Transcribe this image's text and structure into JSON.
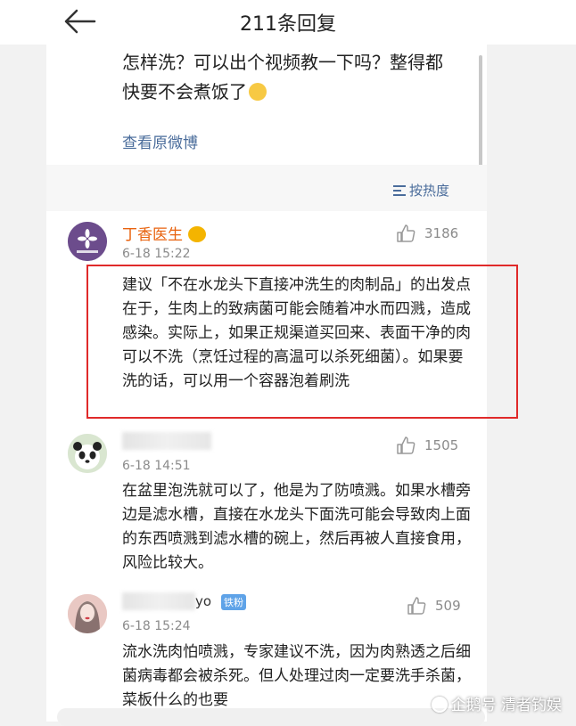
{
  "header": {
    "title": "211条回复"
  },
  "original_post": {
    "text_line1": "怎样洗？可以出个视频教一下吗？整得都",
    "text_line2": "快要不会煮饭了",
    "view_original_label": "查看原微博"
  },
  "sort": {
    "label": "按热度"
  },
  "comments": [
    {
      "username": "丁香医生",
      "time": "6-18 15:22",
      "likes": "3186",
      "text": "建议「不在水龙头下直接冲洗生的肉制品」的出发点在于，生肉上的致病菌可能会随着冲水而四溅，造成感染。实际上，如果正规渠道买回来、表面干净的肉可以不洗（烹饪过程的高温可以杀死细菌）。如果要洗的话，可以用一个容器泡着刷洗",
      "avatar_text": "丁香医生"
    },
    {
      "time": "6-18 14:51",
      "likes": "1505",
      "text": "在盆里泡洗就可以了，他是为了防喷溅。如果水槽旁边是滤水槽，直接在水龙头下面洗可能会导致肉上面的东西喷溅到滤水槽的碗上，然后再被人直接食用，风险比较大。"
    },
    {
      "username_tail": "yo",
      "badge": "铁粉",
      "time": "6-18 15:24",
      "likes": "509",
      "text": "流水洗肉怕喷溅，专家建议不洗，因为肉熟透之后细菌病毒都会被杀死。但人处理过肉一定要洗手杀菌，菜板什么的也要"
    }
  ],
  "watermark": {
    "text": "企鹅号 清者钓娱"
  },
  "colors": {
    "accent_link": "#4a6c9b",
    "username": "#e8620e",
    "highlight_box": "#e02a2a"
  }
}
